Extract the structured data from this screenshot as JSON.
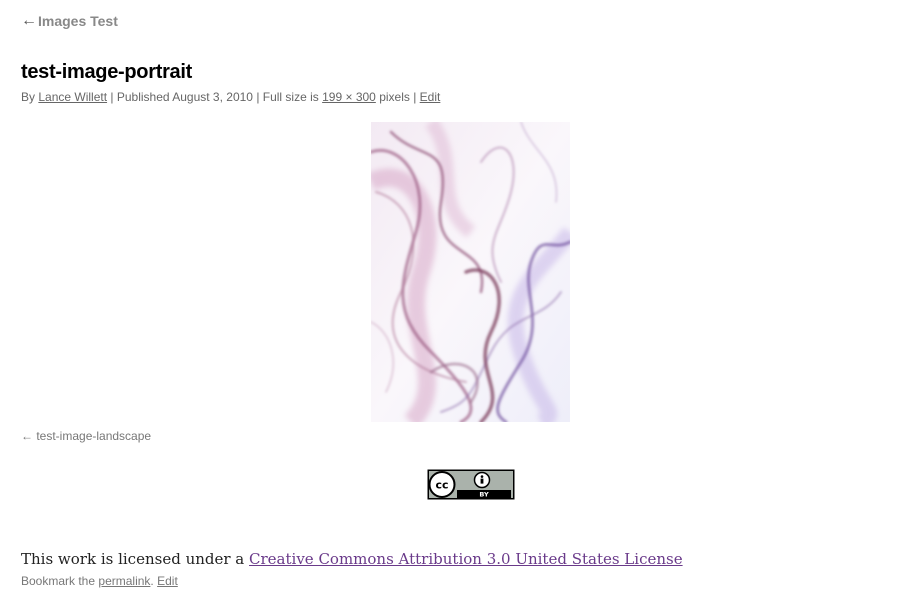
{
  "nav": {
    "back_arrow": "←",
    "back_label": "Images Test"
  },
  "post": {
    "title": "test-image-portrait",
    "meta": {
      "by": "By",
      "author": "Lance Willett",
      "published_prefix": "| Published",
      "date": "August 3, 2010",
      "fullsize_prefix": "| Full size is",
      "dimensions": "199 × 300",
      "pixels_suffix": "pixels |",
      "edit": "Edit"
    },
    "image": {
      "alt": "test-image-portrait",
      "icon": "smoke-photo"
    }
  },
  "image_nav": {
    "arrow": "←",
    "label": "test-image-landscape"
  },
  "license_badge": {
    "cc": "cc",
    "by": "BY"
  },
  "license": {
    "prefix": "This work is licensed under a",
    "link": "Creative Commons Attribution 3.0 United States License"
  },
  "utility": {
    "bookmark": "Bookmark the",
    "permalink": "permalink",
    "separator": ".",
    "edit": "Edit"
  },
  "colors": {
    "link_purple": "#6a3a8a",
    "smoke_mauve": "#a06a8a",
    "smoke_violet": "#7a5aa8"
  }
}
